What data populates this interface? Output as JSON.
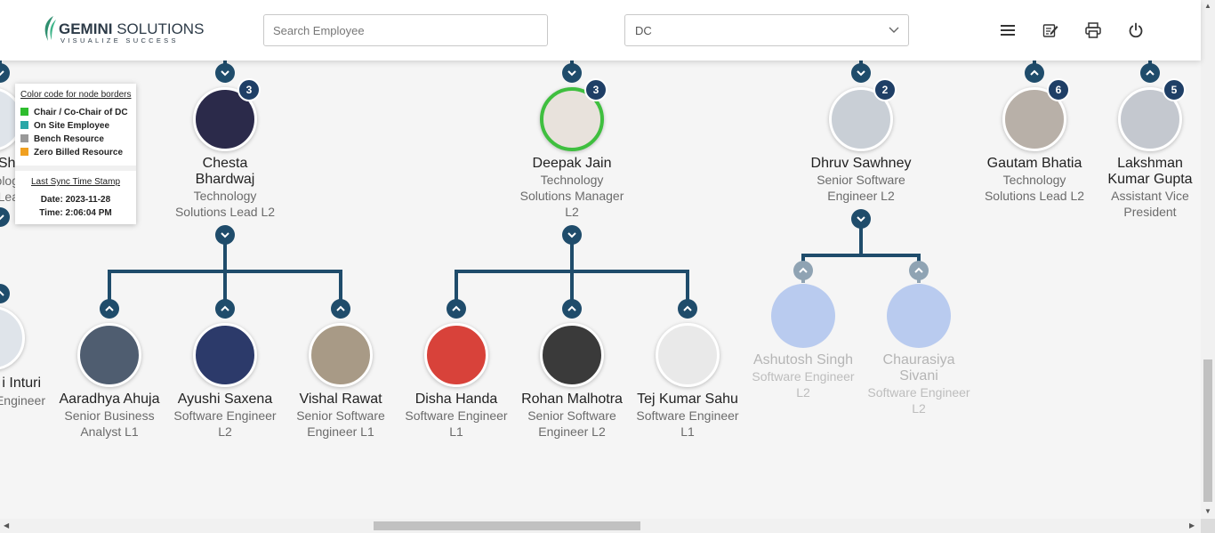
{
  "header": {
    "logo_brand": "GEMINI",
    "logo_suffix": "SOLUTIONS",
    "logo_tagline": "VISUALIZE SUCCESS",
    "search_placeholder": "Search Employee",
    "dc_select_value": "DC",
    "icons": [
      "menu-icon",
      "edit-note-icon",
      "print-icon",
      "power-icon"
    ]
  },
  "legend": {
    "title": "Color code for node borders",
    "items": [
      {
        "label": "Chair / Co-Chair of DC",
        "color": "#2ebd2e"
      },
      {
        "label": "On Site Employee",
        "color": "#2aa7a7"
      },
      {
        "label": "Bench Resource",
        "color": "#999999"
      },
      {
        "label": "Zero Billed Resource",
        "color": "#f0a020"
      }
    ],
    "sync_title": "Last Sync Time Stamp",
    "sync_date": "Date: 2023-11-28",
    "sync_time": "Time: 2:06:04 PM"
  },
  "top_nodes": [
    {
      "name": "Chesta Bhardwaj",
      "role": "Technology Solutions Lead L2",
      "count": "3"
    },
    {
      "name": "Deepak Jain",
      "role": "Technology Solutions Manager L2",
      "count": "3",
      "border": "chair"
    },
    {
      "name": "Dhruv Sawhney",
      "role": "Senior Software Engineer L2",
      "count": "2"
    },
    {
      "name": "Gautam Bhatia",
      "role": "Technology Solutions Lead L2",
      "count": "6"
    },
    {
      "name": "Lakshman Kumar Gupta",
      "role": "Assistant Vice President",
      "count": "5"
    }
  ],
  "partial_nodes": {
    "top_name_fragment": "Sharm",
    "top_role_fragment_1": "olog",
    "top_role_fragment_2": "Lea",
    "bottom_name_fragment": "i Inturi",
    "bottom_role_fragment": "Engineer"
  },
  "child_nodes": [
    {
      "name": "Aaradhya Ahuja",
      "role": "Senior Business Analyst L1"
    },
    {
      "name": "Ayushi Saxena",
      "role": "Software Engineer L2"
    },
    {
      "name": "Vishal Rawat",
      "role": "Senior Software Engineer L1"
    },
    {
      "name": "Disha Handa",
      "role": "Software Engineer L1"
    },
    {
      "name": "Rohan Malhotra",
      "role": "Senior Software Engineer L2"
    },
    {
      "name": "Tej Kumar Sahu",
      "role": "Software Engineer L1"
    },
    {
      "name": "Ashutosh Singh",
      "role": "Software Engineer L2",
      "faded": true
    },
    {
      "name": "Chaurasiya Sivani",
      "role": "Software Engineer L2",
      "faded": true
    }
  ]
}
